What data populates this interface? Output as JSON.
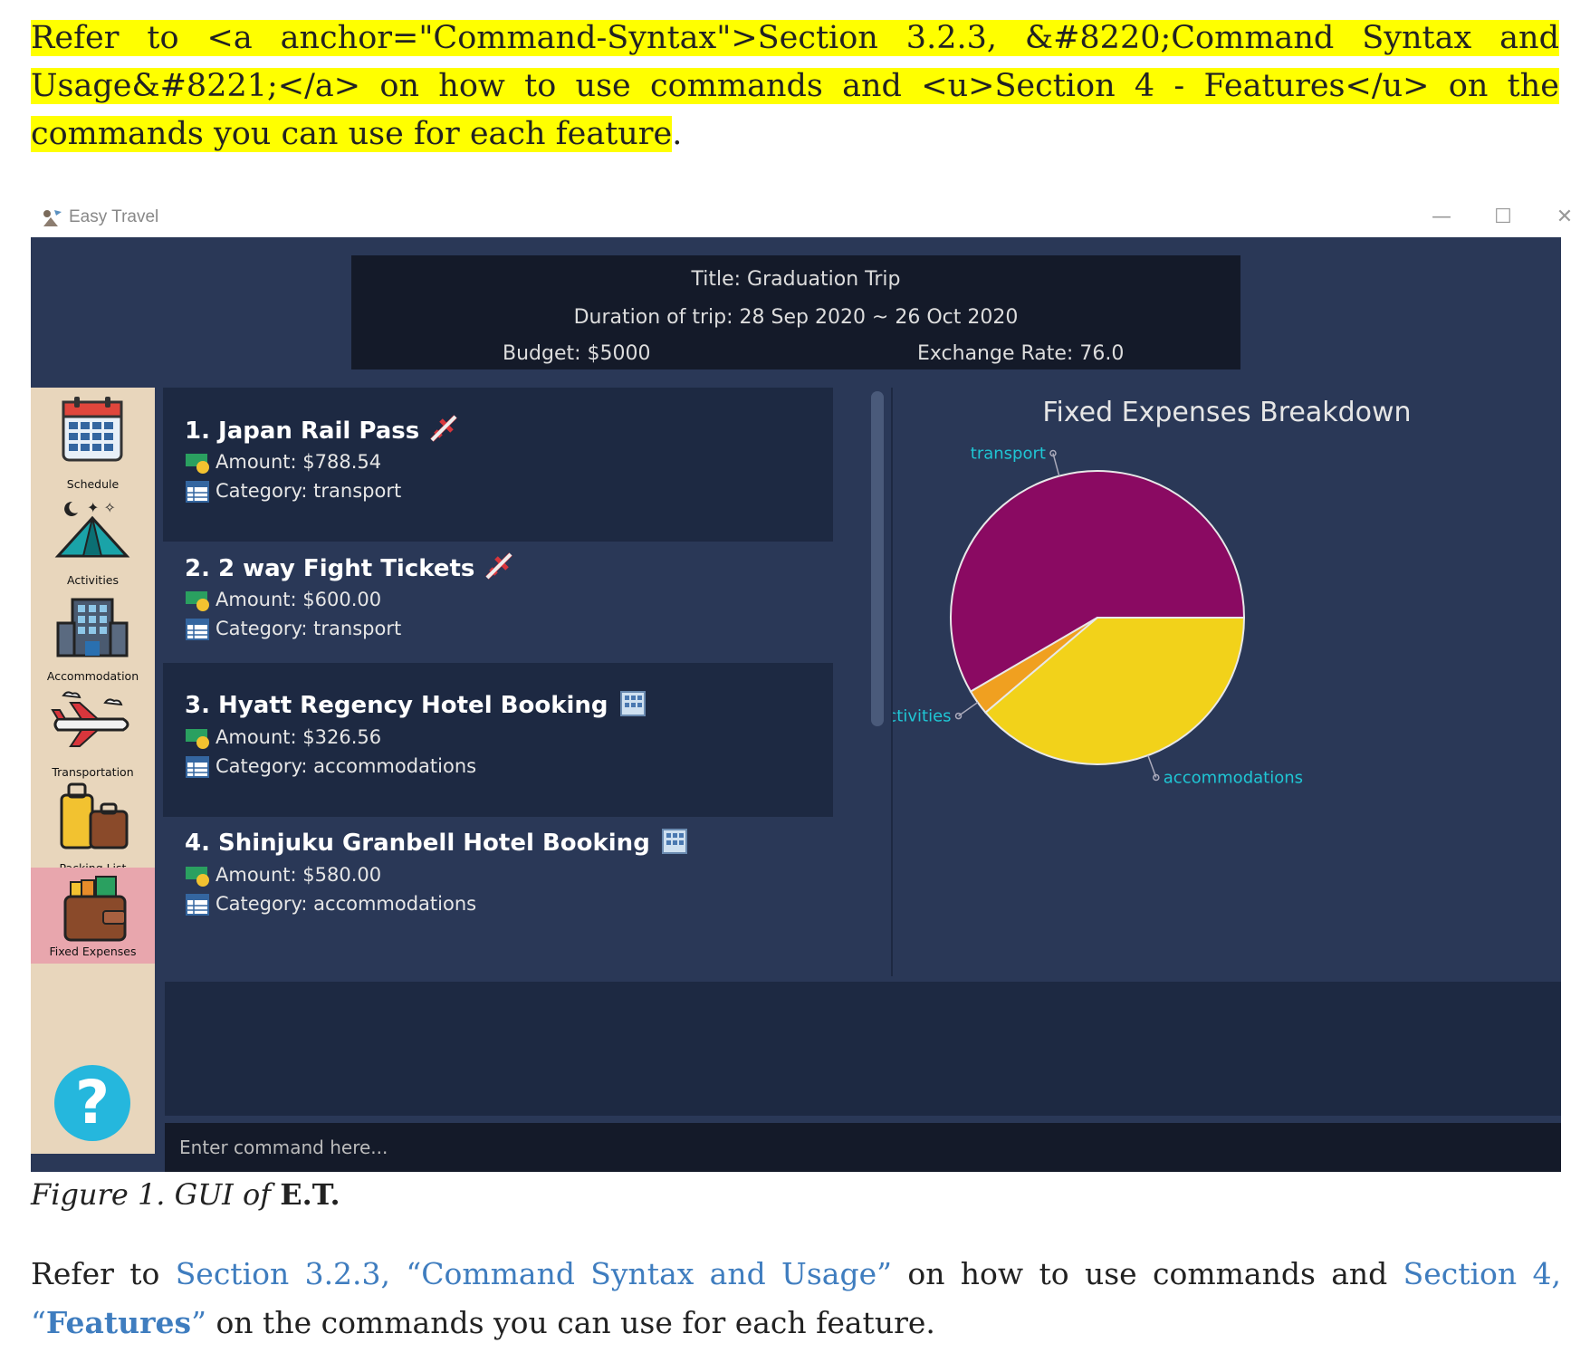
{
  "intro_paragraph": {
    "text": "Refer to <a anchor=\"Command-Syntax\">Section 3.2.3, &#8220;Command Syntax and Usage&#8221;</a> on how to use commands and <u>Section 4 - Features</u> on the commands you can use for each feature",
    "end_punct": "."
  },
  "window": {
    "title": "Easy Travel",
    "minimize": "—",
    "maximize": "☐",
    "close": "✕"
  },
  "header": {
    "title": "Title: Graduation Trip",
    "duration": "Duration of trip: 28 Sep 2020 ~ 26 Oct 2020",
    "budget": "Budget: $5000",
    "exchange_rate": "Exchange Rate: 76.0"
  },
  "sidebar": {
    "items": [
      {
        "label": "Schedule",
        "icon": "calendar-icon"
      },
      {
        "label": "Activities",
        "icon": "tent-icon"
      },
      {
        "label": "Accommodation",
        "icon": "building-icon"
      },
      {
        "label": "Transportation",
        "icon": "airplane-icon"
      },
      {
        "label": "Packing List",
        "icon": "luggage-icon"
      },
      {
        "label": "Fixed Expenses",
        "icon": "wallet-icon",
        "active": true
      }
    ],
    "help": "?"
  },
  "expenses": [
    {
      "name": "1.  Japan Rail Pass",
      "emoji": "✈️",
      "amount": "Amount: $788.54",
      "category": "Category: transport"
    },
    {
      "name": "2.  2 way Fight Tickets",
      "emoji": "✈️",
      "amount": "Amount: $600.00",
      "category": "Category: transport"
    },
    {
      "name": "3.  Hyatt Regency Hotel Booking",
      "emoji": "🏢",
      "amount": "Amount: $326.56",
      "category": "Category: accommodations"
    },
    {
      "name": "4.  Shinjuku Granbell Hotel Booking",
      "emoji": "🏢",
      "amount": "Amount: $580.00",
      "category": "Category: accommodations"
    }
  ],
  "command": {
    "placeholder": "Enter command here..."
  },
  "chart_data": {
    "type": "pie",
    "title": "Fixed Expenses Breakdown",
    "categories": [
      "transport",
      "activities",
      "accommodations"
    ],
    "values": [
      58.4,
      2.8,
      38.8
    ],
    "colors": [
      "#8a0a62",
      "#f0a020",
      "#f2d21a"
    ],
    "legend": "none"
  },
  "caption": {
    "prefix": "Figure 1. GUI of ",
    "bold": "E.T."
  },
  "paragraph2": {
    "p1": "Refer to ",
    "link1": "Section 3.2.3, “Command Syntax and Usage”",
    "p2": " on how to use commands and ",
    "link2a": "Section 4, “",
    "link2b": "Features",
    "link2c": "”",
    "p3": " on the commands you can use for each feature."
  }
}
